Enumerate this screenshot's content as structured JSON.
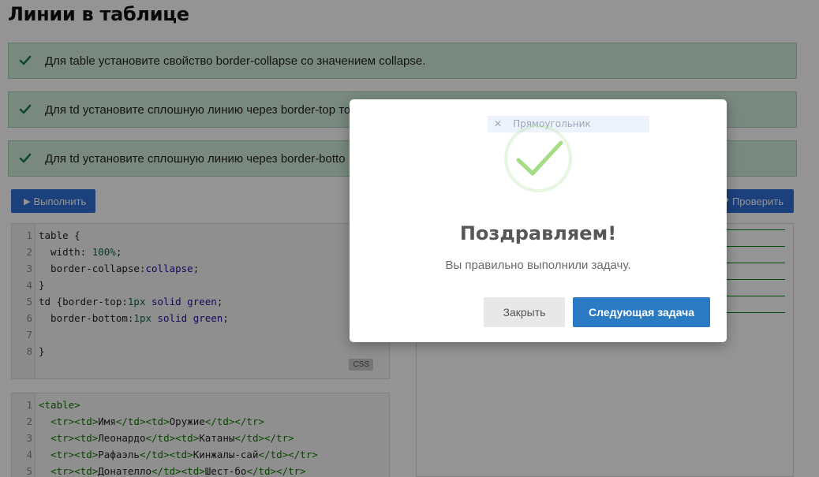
{
  "page": {
    "title": "Линии в таблице",
    "tasks": [
      {
        "text": "Для table установите свойство border-collapse со значением collapse."
      },
      {
        "text": "Для td установите сплошную линию через border-top то"
      },
      {
        "text": "Для td установите сплошную линию через border-botto"
      }
    ],
    "run_button": "Выполнить",
    "check_button": "Проверить",
    "css_badge": "CSS",
    "css_lines": [
      {
        "n": "1",
        "html": "table {"
      },
      {
        "n": "2",
        "html": "  width: <span class=\"num\">100%</span>;"
      },
      {
        "n": "3",
        "html": "  border-collapse:<span class=\"kw\">collapse</span>;"
      },
      {
        "n": "4",
        "html": "}"
      },
      {
        "n": "5",
        "html": "td {border-top:<span class=\"num\">1px</span> <span class=\"kw\">solid</span> <span class=\"kw\">green</span>;"
      },
      {
        "n": "6",
        "html": "  border-bottom:<span class=\"num\">1px</span> <span class=\"kw\">solid</span> <span class=\"kw\">green</span>;"
      },
      {
        "n": "7",
        "html": ""
      },
      {
        "n": "8",
        "html": "}"
      }
    ],
    "html_lines": [
      {
        "n": "1",
        "html": "<span class=\"tag\">&lt;table&gt;</span>"
      },
      {
        "n": "2",
        "html": "  <span class=\"tag\">&lt;tr&gt;&lt;td&gt;</span>Имя<span class=\"tag\">&lt;/td&gt;&lt;td&gt;</span>Оружие<span class=\"tag\">&lt;/td&gt;&lt;/tr&gt;</span>"
      },
      {
        "n": "3",
        "html": "  <span class=\"tag\">&lt;tr&gt;&lt;td&gt;</span>Леонардо<span class=\"tag\">&lt;/td&gt;&lt;td&gt;</span>Катаны<span class=\"tag\">&lt;/td&gt;&lt;/tr&gt;</span>"
      },
      {
        "n": "4",
        "html": "  <span class=\"tag\">&lt;tr&gt;&lt;td&gt;</span>Рафаэль<span class=\"tag\">&lt;/td&gt;&lt;td&gt;</span>Кинжалы-сай<span class=\"tag\">&lt;/td&gt;&lt;/tr&gt;</span>"
      },
      {
        "n": "5",
        "html": "  <span class=\"tag\">&lt;tr&gt;&lt;td&gt;</span>Донателло<span class=\"tag\">&lt;/td&gt;&lt;td&gt;</span>Шест-бо<span class=\"tag\">&lt;/td&gt;&lt;/tr&gt;</span>"
      }
    ]
  },
  "modal": {
    "ghost_tip": "Прямоугольник",
    "title": "Поздравляем!",
    "message": "Вы правильно выполнили задачу.",
    "close_label": "Закрыть",
    "next_label": "Следующая задача",
    "success_icon": "checkmark-icon",
    "success_color": "#a5dc86",
    "next_button_color": "#2b7bc4"
  }
}
